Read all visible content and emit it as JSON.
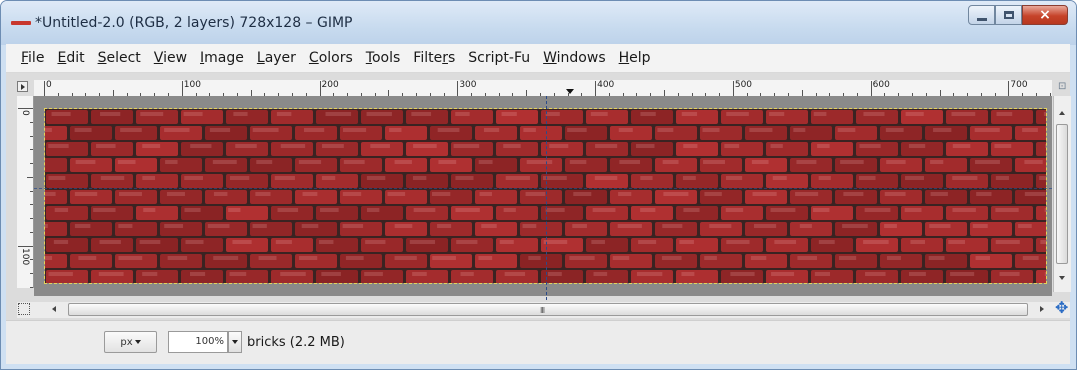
{
  "window": {
    "title": "*Untitled-2.0 (RGB, 2 layers) 728x128 – GIMP",
    "app_icon": "gimp-wilber-icon",
    "controls": {
      "minimize": "minimize-icon",
      "maximize": "maximize-icon",
      "close": "×"
    }
  },
  "menubar": {
    "items": [
      {
        "pre": "",
        "u": "F",
        "post": "ile"
      },
      {
        "pre": "",
        "u": "E",
        "post": "dit"
      },
      {
        "pre": "",
        "u": "S",
        "post": "elect"
      },
      {
        "pre": "",
        "u": "V",
        "post": "iew"
      },
      {
        "pre": "",
        "u": "I",
        "post": "mage"
      },
      {
        "pre": "",
        "u": "L",
        "post": "ayer"
      },
      {
        "pre": "",
        "u": "C",
        "post": "olors"
      },
      {
        "pre": "",
        "u": "T",
        "post": "ools"
      },
      {
        "pre": "Filte",
        "u": "r",
        "post": "s"
      },
      {
        "pre": "Script-Fu",
        "u": "",
        "post": ""
      },
      {
        "pre": "",
        "u": "W",
        "post": "indows"
      },
      {
        "pre": "",
        "u": "H",
        "post": "elp"
      }
    ]
  },
  "rulers": {
    "horizontal_labels": [
      "0",
      "100",
      "200",
      "300",
      "400",
      "500",
      "600",
      "700"
    ],
    "vertical_labels": [
      "0",
      "100"
    ]
  },
  "canvas": {
    "image_size": "728x128",
    "brick_color": "#9e2a2b",
    "mortar_color": "#3a2322",
    "selection_color": "#e5d35a",
    "guide_color": "#2a4b8a"
  },
  "scrollbar": {
    "grip": "III"
  },
  "statusbar": {
    "unit": "px",
    "zoom": "100%",
    "layer_info": "bricks (2.2 MB)"
  },
  "colors": {
    "titlebar": "#c8dbef",
    "menubar": "#f3f3f3",
    "close_button": "#c6432a",
    "navigate_icon": "#2b6cc4"
  }
}
